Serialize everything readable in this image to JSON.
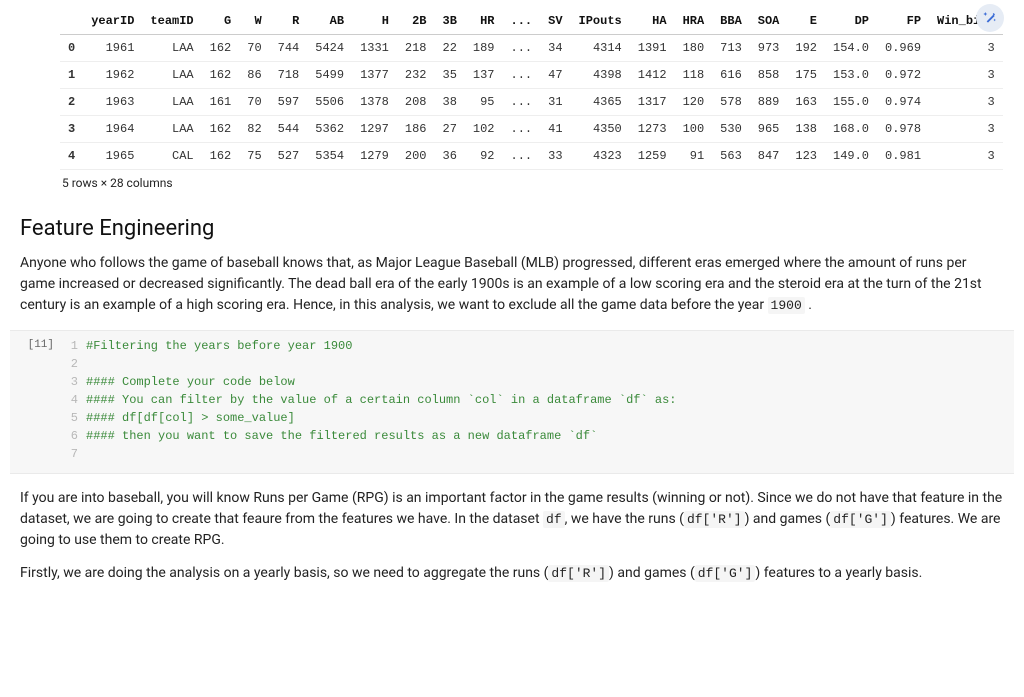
{
  "table": {
    "columns": [
      "",
      "yearID",
      "teamID",
      "G",
      "W",
      "R",
      "AB",
      "H",
      "2B",
      "3B",
      "HR",
      "...",
      "SV",
      "IPouts",
      "HA",
      "HRA",
      "BBA",
      "SOA",
      "E",
      "DP",
      "FP",
      "Win_bins"
    ],
    "rows": [
      [
        "0",
        "1961",
        "LAA",
        "162",
        "70",
        "744",
        "5424",
        "1331",
        "218",
        "22",
        "189",
        "...",
        "34",
        "4314",
        "1391",
        "180",
        "713",
        "973",
        "192",
        "154.0",
        "0.969",
        "3"
      ],
      [
        "1",
        "1962",
        "LAA",
        "162",
        "86",
        "718",
        "5499",
        "1377",
        "232",
        "35",
        "137",
        "...",
        "47",
        "4398",
        "1412",
        "118",
        "616",
        "858",
        "175",
        "153.0",
        "0.972",
        "3"
      ],
      [
        "2",
        "1963",
        "LAA",
        "161",
        "70",
        "597",
        "5506",
        "1378",
        "208",
        "38",
        "95",
        "...",
        "31",
        "4365",
        "1317",
        "120",
        "578",
        "889",
        "163",
        "155.0",
        "0.974",
        "3"
      ],
      [
        "3",
        "1964",
        "LAA",
        "162",
        "82",
        "544",
        "5362",
        "1297",
        "186",
        "27",
        "102",
        "...",
        "41",
        "4350",
        "1273",
        "100",
        "530",
        "965",
        "138",
        "168.0",
        "0.978",
        "3"
      ],
      [
        "4",
        "1965",
        "CAL",
        "162",
        "75",
        "527",
        "5354",
        "1279",
        "200",
        "36",
        "92",
        "...",
        "33",
        "4323",
        "1259",
        "91",
        "563",
        "847",
        "123",
        "149.0",
        "0.981",
        "3"
      ]
    ],
    "dim_note": "5 rows × 28 columns"
  },
  "heading": "Feature Engineering",
  "para1_parts": {
    "t1": "Anyone who follows the game of baseball knows that, as Major League Baseball (MLB) progressed, different eras emerged where the amount of runs per game increased or decreased significantly. The dead ball era of the early 1900s is an example of a low scoring era and the steroid era at the turn of the 21st century is an example of a high scoring era. Hence, in this analysis, we want to exclude all the game data before the year ",
    "c1": "1900",
    "t2": " ."
  },
  "cell": {
    "prompt": "[11]",
    "lines": [
      "#Filtering the years before year 1900",
      "",
      "#### Complete your code below",
      "#### You can filter by the value of a certain column `col` in a dataframe `df` as:",
      "#### df[df[col] > some_value]",
      "#### then you want to save the filtered results as a new dataframe `df`",
      ""
    ]
  },
  "para2_parts": {
    "t1": "If you are into baseball, you will know Runs per Game (RPG) is an important factor in the game results (winning or not). Since we do not have that feature in the dataset, we are going to create that feaure from the features we have. In the dataset ",
    "c1": "df",
    "t2": ", we have the runs (",
    "c2": "df['R']",
    "t3": ") and games (",
    "c3": "df['G']",
    "t4": ") features. We are going to use them to create RPG."
  },
  "para3_parts": {
    "t1": "Firstly, we are doing the analysis on a yearly basis, so we need to aggregate the runs (",
    "c1": "df['R']",
    "t2": ") and games (",
    "c2": "df['G']",
    "t3": ") features to a yearly basis."
  }
}
